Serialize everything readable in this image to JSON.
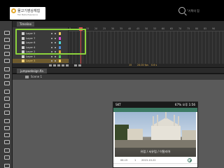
{
  "header": {
    "logo_name": "물고기영상체험",
    "logo_subtitle": "Fish Media Experience",
    "brand_text": "\"기획의 힘"
  },
  "timeline": {
    "tab_label": "Timeline",
    "frame_numbers": [
      "5",
      "10",
      "15",
      "20",
      "25",
      "30",
      "35",
      "40",
      "45",
      "50",
      "55",
      "60",
      "65",
      "70",
      "75",
      "80",
      "85",
      "90"
    ],
    "layers": [
      {
        "name": "Layer 5",
        "color": "#f0d060"
      },
      {
        "name": "Layer 7",
        "color": "#d84dd8"
      },
      {
        "name": "Layer 6",
        "color": "#4fd8d8"
      },
      {
        "name": "Layer 4",
        "color": "#4f8ad8"
      },
      {
        "name": "Layer 2",
        "color": "#d8a040"
      },
      {
        "name": "Layer 1",
        "color": "#58c858"
      },
      {
        "name": "Layer 3",
        "color": "#f0d060",
        "active": true
      }
    ],
    "status": {
      "frame": "15",
      "fps": "24.00 fps",
      "time": "0.6 s"
    }
  },
  "document": {
    "file_tab": "jumpwebsign.fla",
    "scene_label": "Scene 1"
  },
  "phone": {
    "carrier": "SKT",
    "status_right": "67% 오후 1:56",
    "caption": "유럽 / 서유럽 / 이탈리아",
    "meta_left": "06.15",
    "meta_mid": "1",
    "meta_right": "2015.10.22"
  },
  "colors": {
    "highlight": "#8cd33c",
    "app_green": "#3d7a64",
    "active_layer": "#6e5b2e"
  }
}
